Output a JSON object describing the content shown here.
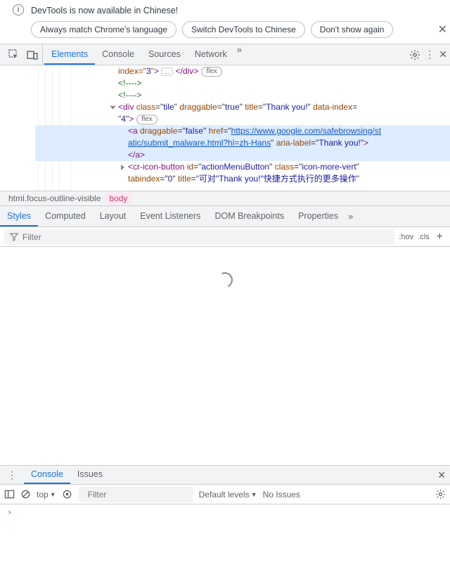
{
  "infobar": {
    "message": "DevTools is now available in Chinese!",
    "btn_match": "Always match Chrome's language",
    "btn_switch": "Switch DevTools to Chinese",
    "btn_dont": "Don't show again"
  },
  "main_tabs": {
    "elements": "Elements",
    "console": "Console",
    "sources": "Sources",
    "network": "Network"
  },
  "dom": {
    "l1_pre": "index=\"",
    "l1_val": "3",
    "l1_post": "\"",
    "flex": "flex",
    "cmt_open": "<!---->",
    "cmt_close": "<!---->",
    "div_open_class": "class",
    "div_open_class_v": "tile",
    "div_open_drag": "draggable",
    "div_open_drag_v": "true",
    "div_open_title": "title",
    "div_open_title_v": "Thank you!",
    "div_open_idx": "data-index",
    "div_open_idx_v": "4",
    "a_drag": "draggable",
    "a_drag_v": "false",
    "a_href": "href",
    "a_href_v1": "https://www.google.com/safebrowsing/st",
    "a_href_v2": "atic/submit_malware.html?hl=zh-Hans",
    "a_aria": "aria-label",
    "a_aria_v": "Thank you!",
    "cr_id": "id",
    "cr_id_v": "actionMenuButton",
    "cr_class": "class",
    "cr_class_v": "icon-more-vert",
    "cr_tab": "tabindex",
    "cr_tab_v": "0",
    "cr_title": "title",
    "cr_title_v": "可对\"Thank you!\"快捷方式执行的更多操作"
  },
  "crumbs": {
    "html": "html.focus-outline-visible",
    "body": "body"
  },
  "sub_tabs": {
    "styles": "Styles",
    "computed": "Computed",
    "layout": "Layout",
    "events": "Event Listeners",
    "dom_brk": "DOM Breakpoints",
    "props": "Properties"
  },
  "styles_filter": {
    "placeholder": "Filter",
    "hov": ":hov",
    "cls": ".cls"
  },
  "drawer": {
    "tab_console": "Console",
    "tab_issues": "Issues",
    "ctx": "top",
    "filter_ph": "Filter",
    "levels": "Default levels",
    "no_issues": "No Issues"
  }
}
